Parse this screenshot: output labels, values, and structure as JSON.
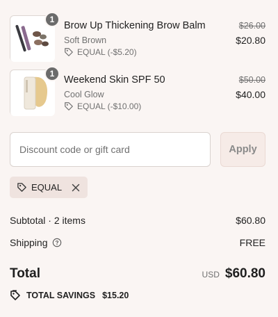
{
  "line_items": [
    {
      "quantity": "1",
      "title": "Brow Up Thickening Brow Balm",
      "variant": "Soft Brown",
      "discount": "EQUAL (-$5.20)",
      "original_price": "$26.00",
      "final_price": "$20.80"
    },
    {
      "quantity": "1",
      "title": "Weekend Skin SPF 50",
      "variant": "Cool Glow",
      "discount": "EQUAL (-$10.00)",
      "original_price": "$50.00",
      "final_price": "$40.00"
    }
  ],
  "discount_form": {
    "placeholder": "Discount code or gift card",
    "value": "",
    "apply_label": "Apply"
  },
  "applied_code": {
    "code": "EQUAL",
    "remove_icon": "close-icon",
    "tag_icon": "tag-icon"
  },
  "summary": {
    "subtotal_label": "Subtotal · 2 items",
    "subtotal_value": "$60.80",
    "shipping_label": "Shipping",
    "shipping_value": "FREE",
    "total_label": "Total",
    "currency": "USD",
    "total_value": "$60.80",
    "savings_label": "TOTAL SAVINGS",
    "savings_value": "$15.20"
  },
  "colors": {
    "background": "#faf5f3",
    "badge": "#6b6b6b",
    "chip_background": "#efe3df",
    "apply_background": "#f6ebe7",
    "muted_text": "#707070"
  }
}
